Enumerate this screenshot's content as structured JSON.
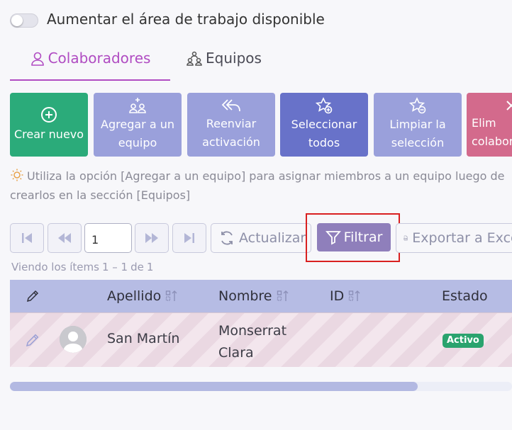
{
  "workspace_toggle": {
    "label": "Aumentar el área de trabajo disponible",
    "checked": false
  },
  "tabs": [
    {
      "label": "Colaboradores",
      "icon": "user-icon",
      "active": true
    },
    {
      "label": "Equipos",
      "icon": "team-icon",
      "active": false
    }
  ],
  "actions": [
    {
      "label": "Crear nuevo",
      "icon": "plus-circle-icon",
      "color": "#2bab7a"
    },
    {
      "label": "Agregar a un\nequipo",
      "icon": "add-team-icon",
      "color": "#9aa0db"
    },
    {
      "label": "Reenviar\nactivación",
      "icon": "reply-all-icon",
      "color": "#9aa0db"
    },
    {
      "label": "Seleccionar\ntodos",
      "icon": "star-plus-icon",
      "color": "#6872c9"
    },
    {
      "label": "Limpiar la\nselección",
      "icon": "star-minus-icon",
      "color": "#9aa0db"
    },
    {
      "label": "Elim\ncolabor",
      "icon": "close-icon",
      "color": "#d36a8c"
    }
  ],
  "hint": "Utiliza la opción [Agregar a un equipo] para asignar miembros a un equipo luego de crearlos en la sección [Equipos]",
  "pager": {
    "page": "1",
    "refresh_label": "Actualizar",
    "filter_label": "Filtrar",
    "export_label": "Exportar a Excel",
    "viewing_label": "Viendo los ítems",
    "viewing_range": "1 – 1",
    "viewing_of": "de",
    "viewing_total": "1"
  },
  "table": {
    "columns": [
      "Apellido",
      "Nombre",
      "ID",
      "Estado"
    ],
    "rows": [
      {
        "apellido": "San Martín",
        "nombre_1": "Monserrat",
        "nombre_2": "Clara",
        "id": "",
        "estado": "Activo"
      }
    ]
  },
  "colors": {
    "accent": "#b04cc2",
    "filter": "#8f7fbb",
    "status_active": "#2aa36e",
    "highlight": "#d92020"
  }
}
